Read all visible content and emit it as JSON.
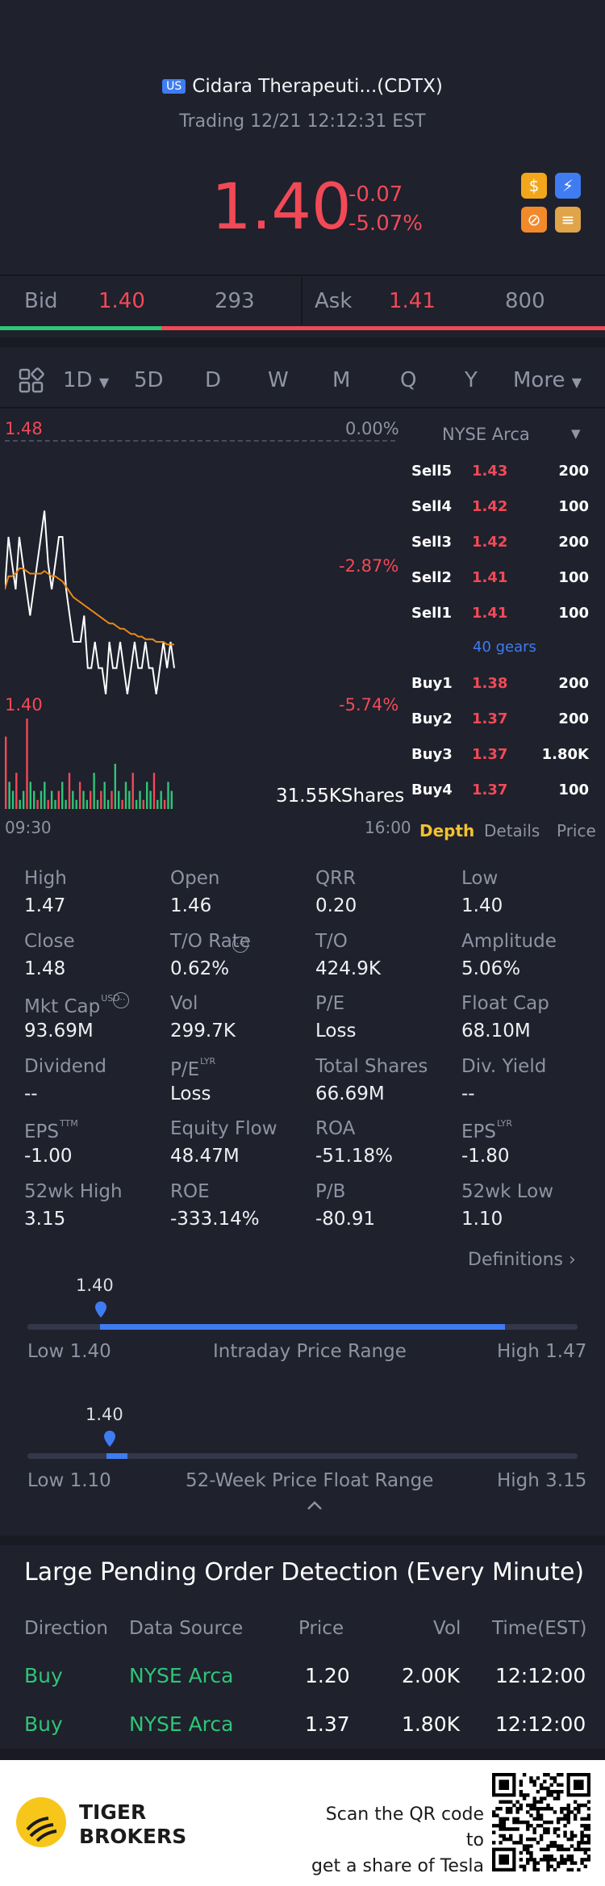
{
  "header": {
    "market_badge": "US",
    "title": "Cidara Therapeuti...(CDTX)",
    "status": "Trading 12/21 12:12:31 EST",
    "price": "1.40",
    "change": "-0.07",
    "change_pct": "-5.07%"
  },
  "bid_ask": {
    "bid_label": "Bid",
    "bid_price": "1.40",
    "bid_vol": "293",
    "ask_label": "Ask",
    "ask_price": "1.41",
    "ask_vol": "800"
  },
  "periods": [
    "1D",
    "5D",
    "D",
    "W",
    "M",
    "Q",
    "Y",
    "More"
  ],
  "chart": {
    "high_price": "1.48",
    "high_pct": "0.00%",
    "mid_pct": "-2.87%",
    "low_price": "1.40",
    "low_pct": "-5.74%",
    "volume": "31.55KShares",
    "start_time": "09:30",
    "end_time": "16:00",
    "price_series": [
      1.44,
      1.46,
      1.45,
      1.44,
      1.46,
      1.45,
      1.44,
      1.43,
      1.44,
      1.45,
      1.46,
      1.47,
      1.45,
      1.44,
      1.45,
      1.46,
      1.46,
      1.44,
      1.43,
      1.42,
      1.42,
      1.42,
      1.43,
      1.41,
      1.41,
      1.42,
      1.41,
      1.41,
      1.4,
      1.42,
      1.41,
      1.41,
      1.42,
      1.41,
      1.4,
      1.41,
      1.42,
      1.41,
      1.41,
      1.42,
      1.41,
      1.41,
      1.4,
      1.41,
      1.42,
      1.41,
      1.42,
      1.41
    ],
    "avg_series": [
      1.44,
      1.445,
      1.445,
      1.446,
      1.448,
      1.448,
      1.447,
      1.446,
      1.446,
      1.446,
      1.446,
      1.447,
      1.446,
      1.445,
      1.445,
      1.444,
      1.443,
      1.441,
      1.439,
      1.437,
      1.436,
      1.435,
      1.434,
      1.433,
      1.432,
      1.431,
      1.43,
      1.429,
      1.428,
      1.427,
      1.427,
      1.426,
      1.425,
      1.425,
      1.424,
      1.423,
      1.423,
      1.422,
      1.422,
      1.421,
      1.421,
      1.421,
      1.42,
      1.42,
      1.42,
      1.419,
      1.419,
      1.419
    ],
    "volume_series": [
      0.8,
      0.3,
      0.2,
      0.4,
      0.1,
      0.2,
      1.0,
      0.3,
      0.2,
      0.1,
      0.2,
      0.3,
      0.1,
      0.2,
      0.1,
      0.2,
      0.3,
      0.1,
      0.4,
      0.2,
      0.1,
      0.3,
      0.2,
      0.1,
      0.2,
      0.4,
      0.1,
      0.2,
      0.3,
      0.1,
      0.2,
      0.5,
      0.2,
      0.1,
      0.3,
      0.2,
      0.4,
      0.1,
      0.2,
      0.1,
      0.3,
      0.2,
      0.4,
      0.1,
      0.2,
      0.1,
      0.3,
      0.2
    ]
  },
  "order_book": {
    "exchange": "NYSE Arca",
    "sells": [
      {
        "label": "Sell5",
        "price": "1.43",
        "vol": "200"
      },
      {
        "label": "Sell4",
        "price": "1.42",
        "vol": "100"
      },
      {
        "label": "Sell3",
        "price": "1.42",
        "vol": "200"
      },
      {
        "label": "Sell2",
        "price": "1.41",
        "vol": "100"
      },
      {
        "label": "Sell1",
        "price": "1.41",
        "vol": "100"
      }
    ],
    "gears": "40 gears",
    "buys": [
      {
        "label": "Buy1",
        "price": "1.38",
        "vol": "200"
      },
      {
        "label": "Buy2",
        "price": "1.37",
        "vol": "200"
      },
      {
        "label": "Buy3",
        "price": "1.37",
        "vol": "1.80K"
      },
      {
        "label": "Buy4",
        "price": "1.37",
        "vol": "100"
      }
    ],
    "tabs": [
      "Depth",
      "Details",
      "Price"
    ]
  },
  "stats": [
    [
      {
        "label": "High",
        "value": "1.47"
      },
      {
        "label": "Open",
        "value": "1.46"
      },
      {
        "label": "QRR",
        "value": "0.20"
      },
      {
        "label": "Low",
        "value": "1.40"
      }
    ],
    [
      {
        "label": "Close",
        "value": "1.48"
      },
      {
        "label": "T/O Rate",
        "value": "0.62%"
      },
      {
        "label": "T/O",
        "value": "424.9K"
      },
      {
        "label": "Amplitude",
        "value": "5.06%"
      }
    ],
    [
      {
        "label": "Mkt Cap",
        "value": "93.69M",
        "sup": "USD"
      },
      {
        "label": "Vol",
        "value": "299.7K"
      },
      {
        "label": "P/E",
        "value": "Loss"
      },
      {
        "label": "Float Cap",
        "value": "68.10M"
      }
    ],
    [
      {
        "label": "Dividend",
        "value": "--"
      },
      {
        "label": "P/E",
        "value": "Loss",
        "sup": "LYR"
      },
      {
        "label": "Total Shares",
        "value": "66.69M"
      },
      {
        "label": "Div. Yield",
        "value": "--"
      }
    ],
    [
      {
        "label": "EPS",
        "value": "-1.00",
        "sup": "TTM"
      },
      {
        "label": "Equity Flow",
        "value": "48.47M"
      },
      {
        "label": "ROA",
        "value": "-51.18%"
      },
      {
        "label": "EPS",
        "value": "-1.80",
        "sup": "LYR"
      }
    ],
    [
      {
        "label": "52wk High",
        "value": "3.15"
      },
      {
        "label": "ROE",
        "value": "-333.14%"
      },
      {
        "label": "P/B",
        "value": "-80.91"
      },
      {
        "label": "52wk Low",
        "value": "1.10"
      }
    ]
  ],
  "definitions": "Definitions",
  "intraday": {
    "marker": "1.40",
    "low": "Low 1.40",
    "title": "Intraday Price Range",
    "high": "High 1.47",
    "position": 0.0
  },
  "week52": {
    "marker": "1.40",
    "low": "Low 1.10",
    "title": "52-Week Price Float Range",
    "high": "High 3.15",
    "position": 0.146
  },
  "large_orders": {
    "title": "Large Pending Order Detection (Every Minute)",
    "headers": [
      "Direction",
      "Data Source",
      "Price",
      "Vol",
      "Time(EST)"
    ],
    "rows": [
      {
        "direction": "Buy",
        "source": "NYSE Arca",
        "price": "1.20",
        "vol": "2.00K",
        "time": "12:12:00"
      },
      {
        "direction": "Buy",
        "source": "NYSE Arca",
        "price": "1.37",
        "vol": "1.80K",
        "time": "12:12:00"
      }
    ]
  },
  "footer": {
    "brand_line1": "TIGER",
    "brand_line2": "BROKERS",
    "cta_line1": "Scan the QR code to",
    "cta_line2": "get a share of Tesla"
  },
  "colors": {
    "up": "#2fc477",
    "down": "#f24957",
    "accent": "#3f7cf2",
    "highlight": "#f2c230",
    "avg_line": "#e8891b"
  }
}
